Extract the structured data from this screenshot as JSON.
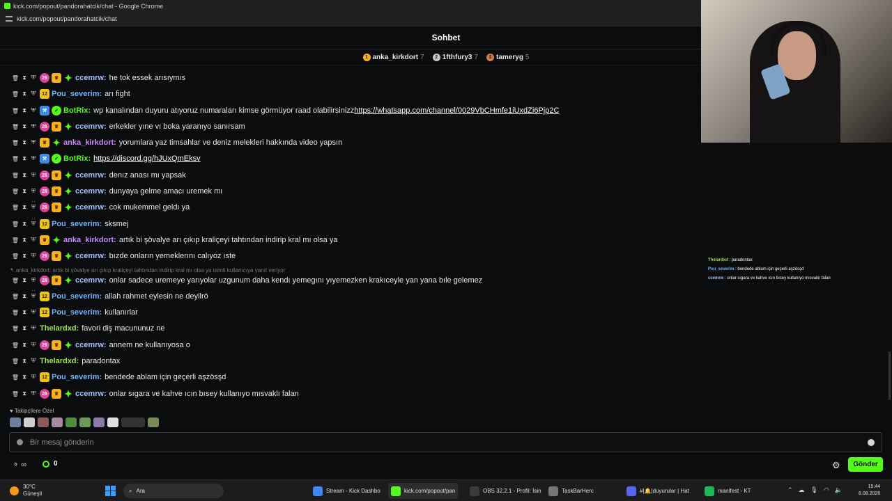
{
  "browser": {
    "window_title": "kick.com/popout/pandorahatcik/chat - Google Chrome",
    "url": "kick.com/popout/pandorahatcik/chat"
  },
  "chat": {
    "title": "Sohbet",
    "gifters": [
      {
        "rank": "1",
        "name": "anka_kirkdort",
        "count": "7",
        "color": "#f6b21c"
      },
      {
        "rank": "2",
        "name": "1fthfury3",
        "count": "7",
        "color": "#c7c7c7"
      },
      {
        "rank": "3",
        "name": "tameryg",
        "count": "5",
        "color": "#cd7f4a"
      }
    ],
    "messages": [
      {
        "badges": [
          "sub",
          "crown",
          "spark"
        ],
        "user": "ccemrw",
        "cls": "u-ccemrw",
        "text": "he tok essek arısıymıs"
      },
      {
        "badges": [
          "12"
        ],
        "user": "Pou_severim",
        "cls": "u-pou",
        "text": "arı fight"
      },
      {
        "badges": [
          "bot",
          "verified"
        ],
        "user": "BotRix",
        "cls": "u-bot",
        "text": "wp kanalından duyuru atıyoruz numaraları kimse görmüyor raad olabilirsinizz ",
        "link": "https://whatsapp.com/channel/0029VbCHmfe1iUxdZi6Pjp2C"
      },
      {
        "badges": [
          "sub",
          "crown",
          "spark"
        ],
        "user": "ccemrw",
        "cls": "u-ccemrw",
        "text": "erkekler yıne vı boka yaranıyo sanırsam"
      },
      {
        "badges": [
          "crown",
          "spark"
        ],
        "user": "anka_kirkdort",
        "cls": "u-anka",
        "text": "yorumlara yaz timsahlar ve deniz melekleri hakkında video yapsın"
      },
      {
        "badges": [
          "bot",
          "verified"
        ],
        "user": "BotRix",
        "cls": "u-bot",
        "text": "",
        "link": "https://discord.gg/hJUxQmEksv"
      },
      {
        "badges": [
          "sub",
          "crown",
          "spark"
        ],
        "user": "ccemrw",
        "cls": "u-ccemrw",
        "text": "denız anası mı yapsak"
      },
      {
        "badges": [
          "sub",
          "crown",
          "spark"
        ],
        "user": "ccemrw",
        "cls": "u-ccemrw",
        "text": "dunyaya gelme amacı uremek mı"
      },
      {
        "badges": [
          "sub",
          "crown",
          "spark"
        ],
        "user": "ccemrw",
        "cls": "u-ccemrw",
        "text": "cok mukemmel geldı ya"
      },
      {
        "badges": [
          "12"
        ],
        "user": "Pou_severim",
        "cls": "u-pou",
        "text": "sksmej"
      },
      {
        "badges": [
          "crown",
          "spark"
        ],
        "user": "anka_kirkdort",
        "cls": "u-anka",
        "text": "artık bi şövalye arı çıkıp kraliçeyi tahtından indirip kral mı olsa ya"
      },
      {
        "badges": [
          "sub",
          "crown",
          "spark"
        ],
        "user": "ccemrw",
        "cls": "u-ccemrw",
        "text": "bızde onların yemeklerını calıyoz ıste"
      },
      {
        "badges": [
          "sub",
          "crown",
          "spark"
        ],
        "user": "ccemrw",
        "cls": "u-ccemrw",
        "text": "onlar sadece uremeye yarıyolar uzgunum daha kendı yemegını yıyemezken krakıceyle yan yana bıle gelemez"
      },
      {
        "badges": [
          "12"
        ],
        "user": "Pou_severim",
        "cls": "u-pou",
        "text": "allah rahmet eylesin ne deyilrö"
      },
      {
        "badges": [
          "12"
        ],
        "user": "Pou_severim",
        "cls": "u-pou",
        "text": "kullanırlar"
      },
      {
        "badges": [],
        "user": "Thelardxd",
        "cls": "u-the",
        "text": "favori diş macunun­uz ne"
      },
      {
        "badges": [
          "sub",
          "crown",
          "spark"
        ],
        "user": "ccemrw",
        "cls": "u-ccemrw",
        "text": "annem ne kullanıyosa o"
      },
      {
        "badges": [],
        "user": "Thelardxd",
        "cls": "u-the",
        "text": "paradontax"
      },
      {
        "badges": [
          "12"
        ],
        "user": "Pou_severim",
        "cls": "u-pou",
        "text": "bendede ablam için geçerli aşzösşd"
      },
      {
        "badges": [
          "sub",
          "crown",
          "spark"
        ],
        "user": "ccemrw",
        "cls": "u-ccemrw",
        "text": "onlar sıgara ve kahve ıcın bısey kullanıyo mısvaklı falan"
      }
    ],
    "reply_hint": "↰ anka_kirkdort: artık bi şövalye arı çıkıp kraliçeyi tahtından indirip kral mı olsa ya isimli kullanıcıya yanıt veriyor",
    "followers_only": "♥ Takipçilere Özel",
    "input_placeholder": "Bir mesaj gönderin",
    "infinity_label": "∞",
    "points": "0",
    "send_label": "Gönder"
  },
  "overlay": {
    "lines": [
      {
        "user": "Thelardxd",
        "text": " : paradontax",
        "color": "#9fe34e"
      },
      {
        "user": "Pou_severim",
        "text": " : bendede ablam için geçerli aşzösşd",
        "color": "#6fb4ff"
      },
      {
        "user": "ccemrw",
        "text": " : onlar sıgara ve kahve ıcın bısey kullanıyo mısvaklı falan",
        "color": "#a2c0ff"
      }
    ]
  },
  "taskbar": {
    "weather_temp": "30°C",
    "weather_desc": "Güneşli",
    "search_label": "Ara",
    "apps": [
      {
        "label": "Stream - Kick Dashbo",
        "color": "#4285f4"
      },
      {
        "label": "kick.com/popout/pan",
        "color": "#53fc18"
      },
      {
        "label": "OBS 32.2.1 - Profil: İsin",
        "color": "#3b3b3b"
      },
      {
        "label": "TaskBarHerc",
        "color": "#777777"
      },
      {
        "label": "#|🔔|duyurular | Hat",
        "color": "#5865f2"
      },
      {
        "label": "manifest - KT",
        "color": "#1db954"
      }
    ],
    "time": "15:44",
    "date": "8.08.2026"
  }
}
